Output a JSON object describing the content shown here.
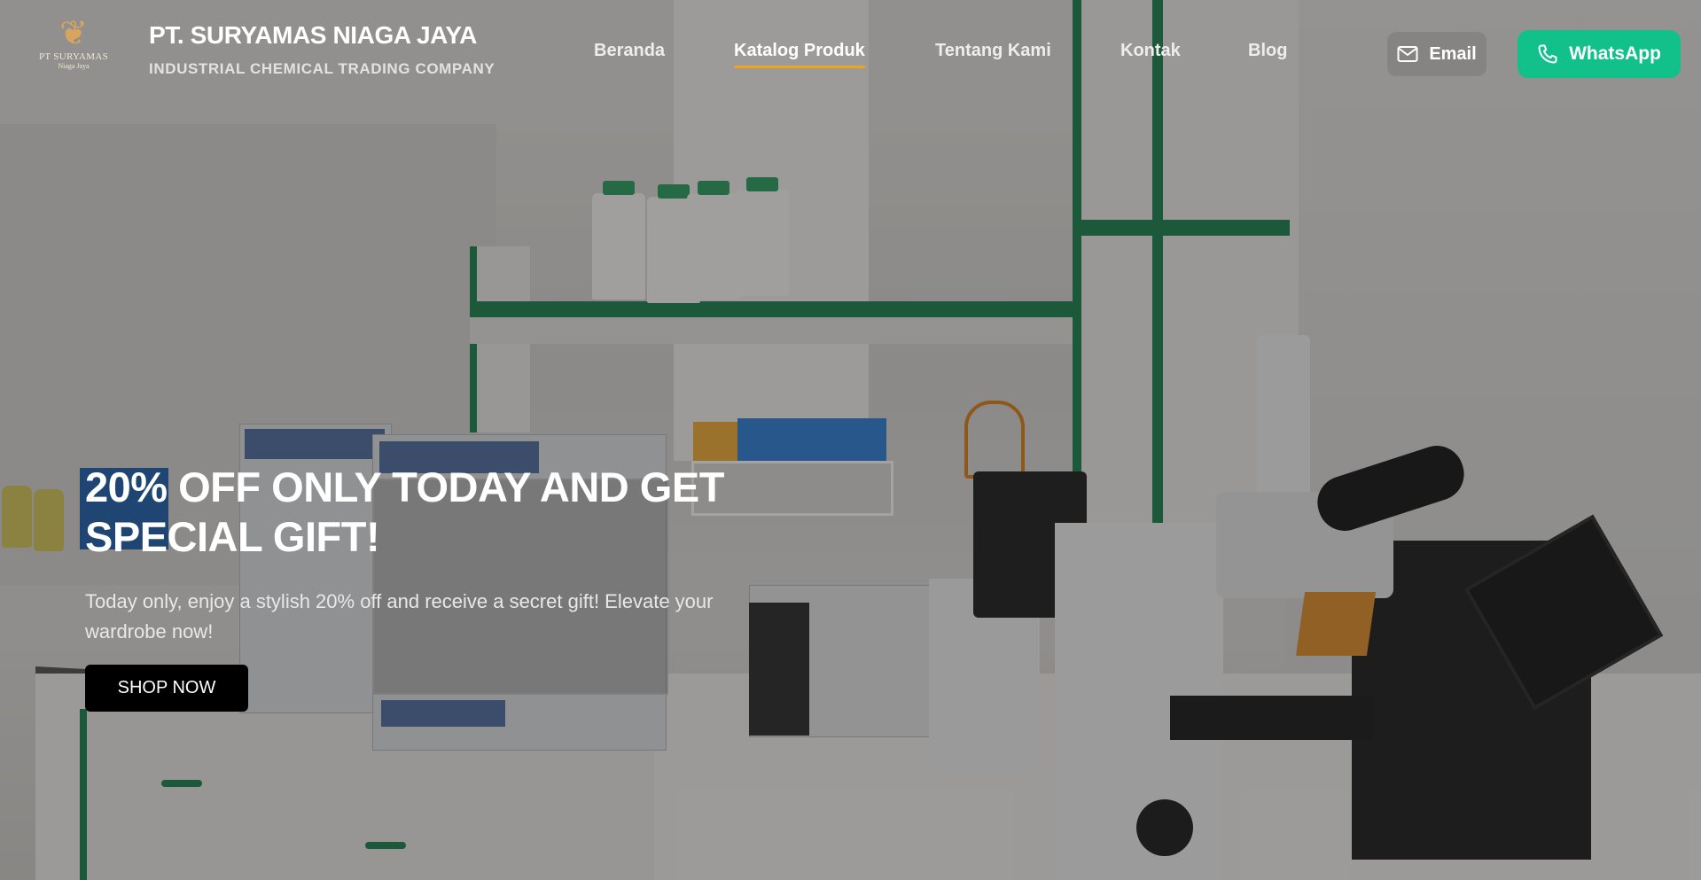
{
  "brand": {
    "logo_name": "PT SURYAMAS",
    "logo_sub": "Niaga Jaya",
    "company_name": "PT. SURYAMAS NIAGA JAYA",
    "tagline": "INDUSTRIAL CHEMICAL TRADING COMPANY"
  },
  "nav": {
    "items": [
      {
        "label": "Beranda",
        "active": false
      },
      {
        "label": "Katalog Produk",
        "active": true
      },
      {
        "label": "Tentang Kami",
        "active": false
      },
      {
        "label": "Kontak",
        "active": false
      },
      {
        "label": "Blog",
        "active": false
      }
    ],
    "email_label": "Email",
    "whatsapp_label": "WhatsApp"
  },
  "hero": {
    "title": "20% OFF ONLY TODAY AND GET SPECIAL GIFT!",
    "text": "Today only, enjoy a stylish 20% off and receive a secret gift! Elevate your wardrobe now!",
    "cta_label": "SHOP NOW"
  },
  "icons": {
    "logo": "leaf-emblem-icon",
    "email": "mail-icon",
    "whatsapp": "phone-icon"
  },
  "colors": {
    "accent": "#f1a31e",
    "whatsapp": "#12c08a",
    "cta": "#000000",
    "lab_green": "#1c7d4c"
  }
}
